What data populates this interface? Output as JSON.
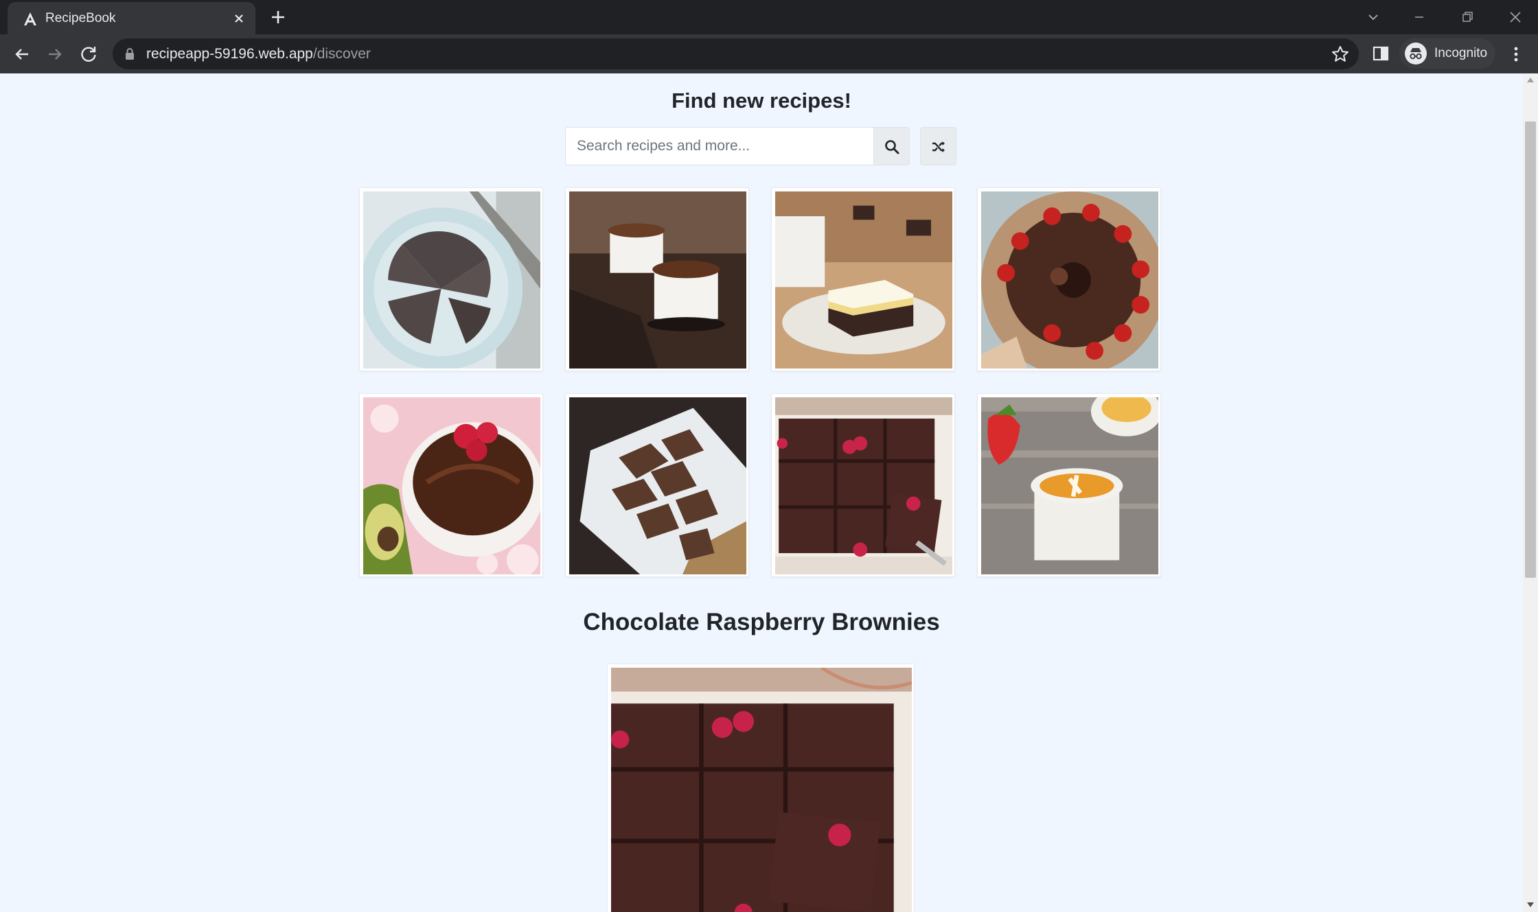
{
  "browser": {
    "tab_title": "RecipeBook",
    "url_host": "recipeapp-59196.web.app",
    "url_path": "/discover",
    "profile_label": "Incognito"
  },
  "page": {
    "heading": "Find new recipes!",
    "search_placeholder": "Search recipes and more...",
    "search_value": "",
    "grid": [
      {
        "image": "chocolate-cake-slices-on-plate"
      },
      {
        "image": "chocolate-souffles-in-ramekins"
      },
      {
        "image": "layered-dessert-bar-on-plate"
      },
      {
        "image": "chocolate-bundt-cake-with-strawberries"
      },
      {
        "image": "chocolate-avocado-pudding-with-raspberries"
      },
      {
        "image": "chocolate-crispy-squares"
      },
      {
        "image": "chocolate-raspberry-brownies"
      },
      {
        "image": "creme-brulee-with-strawberry"
      }
    ],
    "selected_recipe": {
      "title": "Chocolate Raspberry Brownies",
      "image": "chocolate-raspberry-brownies"
    }
  },
  "colors": {
    "page_background": "#f0f6ff",
    "chrome_dark": "#202124",
    "chrome_toolbar": "#35363a",
    "text": "#212529"
  },
  "icons": [
    "back-icon",
    "forward-icon",
    "reload-icon",
    "lock-icon",
    "star-icon",
    "side-panel-icon",
    "incognito-icon",
    "menu-icon",
    "search-icon",
    "shuffle-icon"
  ]
}
